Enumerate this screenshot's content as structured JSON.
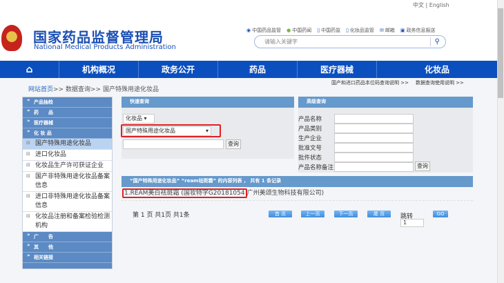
{
  "header": {
    "lang_cn": "中文",
    "lang_sep": "|",
    "lang_en": "English",
    "title_cn": "国家药品监督管理局",
    "title_en": "National Medical Products Administration",
    "links": [
      {
        "icon": "weibo-icon",
        "label": "中国药品监管"
      },
      {
        "icon": "wechat-icon",
        "label": "中国药闻"
      },
      {
        "icon": "mobile-icon",
        "label": "中国药监"
      },
      {
        "icon": "mobile-icon",
        "label": "化妆品监管"
      },
      {
        "icon": "mail-icon",
        "label": "邮箱"
      },
      {
        "icon": "monitor-icon",
        "label": "政务信息报送"
      }
    ],
    "search_placeholder": "请输入关键字"
  },
  "nav": [
    "机构概况",
    "政务公开",
    "药品",
    "医疗器械",
    "化妆品"
  ],
  "breadcrumb": {
    "home": "网站首页",
    "sep": ">>",
    "items": [
      "数据查询",
      "国产特殊用途化妆品"
    ]
  },
  "help_links": [
    "国产和进口药品本位码查询说明 >>",
    "数据查询使用说明 >>"
  ],
  "sidebar": {
    "top": [
      "产品抽检",
      "药　　品",
      "医疗器械",
      "化 妆 品"
    ],
    "sub": [
      "国产特殊用途化妆品",
      "进口化妆品",
      "化妆品生产许可获证企业",
      "国产非特殊用途化妆品备案信息",
      "进口非特殊用途化妆品备案信息",
      "化妆品注册和备案检验检测机构"
    ],
    "bottom": [
      "广　　告",
      "其　　他",
      "相关链接"
    ]
  },
  "quick": {
    "title": "快速查询",
    "category": "化妆品",
    "subcategory": "国产特殊用途化妆品",
    "keyword": "",
    "button": "查询"
  },
  "advanced": {
    "title": "高级查询",
    "fields": [
      "产品名称",
      "产品类别",
      "生产企业",
      "批准文号",
      "批件状态",
      "产品名称备注"
    ],
    "button": "查询"
  },
  "results": {
    "header": "“国产特殊用途化妆品” “ream祛斑霜” 的内容列表 ， 共有 1 条记录",
    "item_highlight": "1.REAM美白祛斑霜 (国妆特字G20181054",
    "item_rest": "广州美颂生物科技有限公司)"
  },
  "pager": {
    "info": "第 1 页 共1页 共1条",
    "first": "首 页",
    "prev": "上一页",
    "next": "下一页",
    "last": "尾 页",
    "jump_label": "跳转",
    "jump_value": "1",
    "go": "GO"
  }
}
